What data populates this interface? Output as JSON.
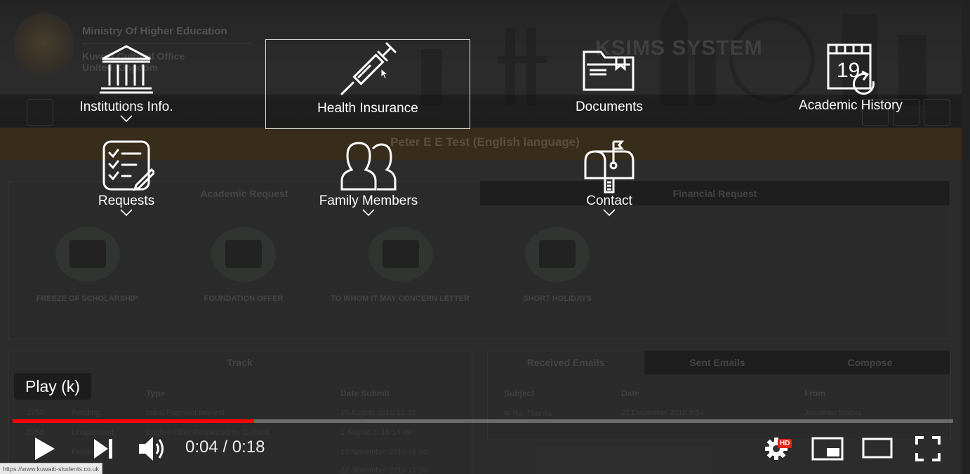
{
  "page": {
    "ministry": "Ministry Of Higher Education",
    "office_line1": "Kuwait Cultural Office",
    "office_line2": "United Kingdom",
    "system_name": "KSIMS SYSTEM",
    "user_banner": "Peter E E Test (English language)",
    "academic_tab": "Academic Request",
    "financial_tab": "Financial Request",
    "requests": [
      {
        "label": "FREEZE OF SCHOLARSHIP"
      },
      {
        "label": "FOUNDATION OFFER"
      },
      {
        "label": "TO WHOM IT MAY CONCERN LETTER"
      },
      {
        "label": "SHORT HOLIDAYS"
      }
    ],
    "track": {
      "title": "Track",
      "headers": [
        "Type",
        "Date Submit"
      ],
      "rows": [
        {
          "id": "2757",
          "status": "Pending",
          "type": "Initial Payment request",
          "date": "15 August 2016 10:23"
        },
        {
          "id": "2753",
          "status": "Unapproved",
          "type": "English Offer Requested by Cultural",
          "date": "1 August 2016 14:49"
        },
        {
          "id": "",
          "status": "Pending",
          "type": "",
          "date": "17 November 2016 15:50"
        },
        {
          "id": "",
          "status": "",
          "type": "",
          "date": "22 November 2016 17:20"
        }
      ]
    },
    "emails": {
      "tabs": [
        "Received Emails",
        "Sent Emails",
        "Compose"
      ],
      "headers": [
        "Subject",
        "Date",
        "From"
      ],
      "rows": [
        {
          "subject": "Re: Thanks",
          "date": "22 December 2016 9:54",
          "from": "Jonathan Mathis"
        }
      ]
    }
  },
  "menu": {
    "items": [
      {
        "label": "Institutions Info.",
        "icon": "institution-building-icon",
        "has_dropdown": true
      },
      {
        "label": "Health Insurance",
        "icon": "syringe-icon",
        "has_dropdown": false,
        "highlighted": true
      },
      {
        "label": "Documents",
        "icon": "folder-icon",
        "has_dropdown": false
      },
      {
        "label": "Academic History",
        "icon": "calendar-history-icon",
        "has_dropdown": false
      },
      {
        "label": "Requests",
        "icon": "checklist-icon",
        "has_dropdown": true
      },
      {
        "label": "Family Members",
        "icon": "people-icon",
        "has_dropdown": true
      },
      {
        "label": "Contact",
        "icon": "mailbox-icon",
        "has_dropdown": true
      }
    ]
  },
  "player": {
    "tooltip": "Play (k)",
    "time_current": "0:04",
    "time_total": "0:18",
    "progress_fraction": 0.257,
    "hd_badge": "HD",
    "accent_color": "#ff0000"
  },
  "status_url": "https://www.kuwaiti-students.co.uk"
}
